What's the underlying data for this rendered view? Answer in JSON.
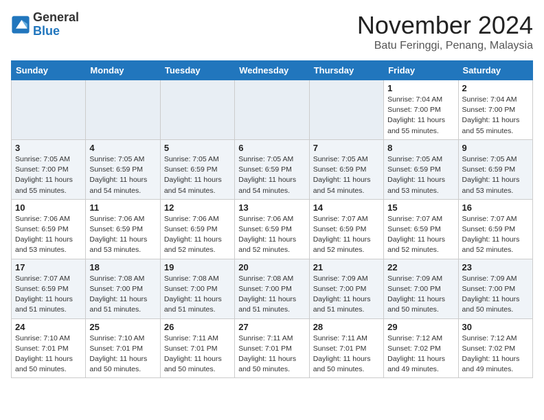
{
  "logo": {
    "general": "General",
    "blue": "Blue"
  },
  "header": {
    "month": "November 2024",
    "location": "Batu Feringgi, Penang, Malaysia"
  },
  "weekdays": [
    "Sunday",
    "Monday",
    "Tuesday",
    "Wednesday",
    "Thursday",
    "Friday",
    "Saturday"
  ],
  "weeks": [
    [
      {
        "day": "",
        "info": ""
      },
      {
        "day": "",
        "info": ""
      },
      {
        "day": "",
        "info": ""
      },
      {
        "day": "",
        "info": ""
      },
      {
        "day": "",
        "info": ""
      },
      {
        "day": "1",
        "info": "Sunrise: 7:04 AM\nSunset: 7:00 PM\nDaylight: 11 hours and 55 minutes."
      },
      {
        "day": "2",
        "info": "Sunrise: 7:04 AM\nSunset: 7:00 PM\nDaylight: 11 hours and 55 minutes."
      }
    ],
    [
      {
        "day": "3",
        "info": "Sunrise: 7:05 AM\nSunset: 7:00 PM\nDaylight: 11 hours and 55 minutes."
      },
      {
        "day": "4",
        "info": "Sunrise: 7:05 AM\nSunset: 6:59 PM\nDaylight: 11 hours and 54 minutes."
      },
      {
        "day": "5",
        "info": "Sunrise: 7:05 AM\nSunset: 6:59 PM\nDaylight: 11 hours and 54 minutes."
      },
      {
        "day": "6",
        "info": "Sunrise: 7:05 AM\nSunset: 6:59 PM\nDaylight: 11 hours and 54 minutes."
      },
      {
        "day": "7",
        "info": "Sunrise: 7:05 AM\nSunset: 6:59 PM\nDaylight: 11 hours and 54 minutes."
      },
      {
        "day": "8",
        "info": "Sunrise: 7:05 AM\nSunset: 6:59 PM\nDaylight: 11 hours and 53 minutes."
      },
      {
        "day": "9",
        "info": "Sunrise: 7:05 AM\nSunset: 6:59 PM\nDaylight: 11 hours and 53 minutes."
      }
    ],
    [
      {
        "day": "10",
        "info": "Sunrise: 7:06 AM\nSunset: 6:59 PM\nDaylight: 11 hours and 53 minutes."
      },
      {
        "day": "11",
        "info": "Sunrise: 7:06 AM\nSunset: 6:59 PM\nDaylight: 11 hours and 53 minutes."
      },
      {
        "day": "12",
        "info": "Sunrise: 7:06 AM\nSunset: 6:59 PM\nDaylight: 11 hours and 52 minutes."
      },
      {
        "day": "13",
        "info": "Sunrise: 7:06 AM\nSunset: 6:59 PM\nDaylight: 11 hours and 52 minutes."
      },
      {
        "day": "14",
        "info": "Sunrise: 7:07 AM\nSunset: 6:59 PM\nDaylight: 11 hours and 52 minutes."
      },
      {
        "day": "15",
        "info": "Sunrise: 7:07 AM\nSunset: 6:59 PM\nDaylight: 11 hours and 52 minutes."
      },
      {
        "day": "16",
        "info": "Sunrise: 7:07 AM\nSunset: 6:59 PM\nDaylight: 11 hours and 52 minutes."
      }
    ],
    [
      {
        "day": "17",
        "info": "Sunrise: 7:07 AM\nSunset: 6:59 PM\nDaylight: 11 hours and 51 minutes."
      },
      {
        "day": "18",
        "info": "Sunrise: 7:08 AM\nSunset: 7:00 PM\nDaylight: 11 hours and 51 minutes."
      },
      {
        "day": "19",
        "info": "Sunrise: 7:08 AM\nSunset: 7:00 PM\nDaylight: 11 hours and 51 minutes."
      },
      {
        "day": "20",
        "info": "Sunrise: 7:08 AM\nSunset: 7:00 PM\nDaylight: 11 hours and 51 minutes."
      },
      {
        "day": "21",
        "info": "Sunrise: 7:09 AM\nSunset: 7:00 PM\nDaylight: 11 hours and 51 minutes."
      },
      {
        "day": "22",
        "info": "Sunrise: 7:09 AM\nSunset: 7:00 PM\nDaylight: 11 hours and 50 minutes."
      },
      {
        "day": "23",
        "info": "Sunrise: 7:09 AM\nSunset: 7:00 PM\nDaylight: 11 hours and 50 minutes."
      }
    ],
    [
      {
        "day": "24",
        "info": "Sunrise: 7:10 AM\nSunset: 7:01 PM\nDaylight: 11 hours and 50 minutes."
      },
      {
        "day": "25",
        "info": "Sunrise: 7:10 AM\nSunset: 7:01 PM\nDaylight: 11 hours and 50 minutes."
      },
      {
        "day": "26",
        "info": "Sunrise: 7:11 AM\nSunset: 7:01 PM\nDaylight: 11 hours and 50 minutes."
      },
      {
        "day": "27",
        "info": "Sunrise: 7:11 AM\nSunset: 7:01 PM\nDaylight: 11 hours and 50 minutes."
      },
      {
        "day": "28",
        "info": "Sunrise: 7:11 AM\nSunset: 7:01 PM\nDaylight: 11 hours and 50 minutes."
      },
      {
        "day": "29",
        "info": "Sunrise: 7:12 AM\nSunset: 7:02 PM\nDaylight: 11 hours and 49 minutes."
      },
      {
        "day": "30",
        "info": "Sunrise: 7:12 AM\nSunset: 7:02 PM\nDaylight: 11 hours and 49 minutes."
      }
    ]
  ]
}
